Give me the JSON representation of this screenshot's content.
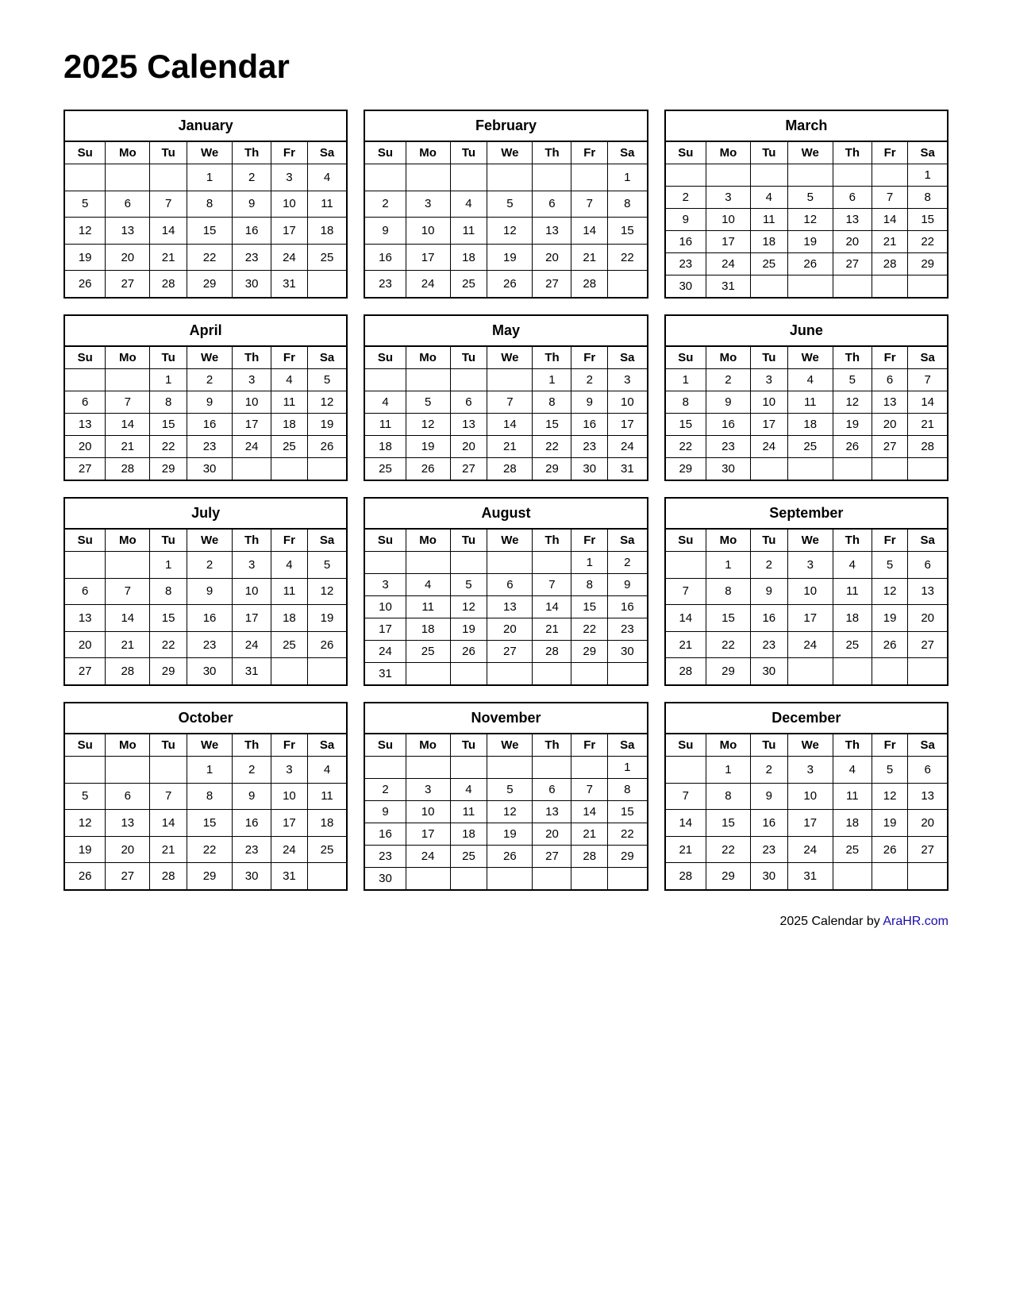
{
  "title": "2025 Calendar",
  "footer": {
    "text": "2025  Calendar by ",
    "link_text": "AraHR.com",
    "link_url": "AraHR.com"
  },
  "months": [
    {
      "name": "January",
      "days_header": [
        "Su",
        "Mo",
        "Tu",
        "We",
        "Th",
        "Fr",
        "Sa"
      ],
      "weeks": [
        [
          "",
          "",
          "",
          "1",
          "2",
          "3",
          "4"
        ],
        [
          "5",
          "6",
          "7",
          "8",
          "9",
          "10",
          "11"
        ],
        [
          "12",
          "13",
          "14",
          "15",
          "16",
          "17",
          "18"
        ],
        [
          "19",
          "20",
          "21",
          "22",
          "23",
          "24",
          "25"
        ],
        [
          "26",
          "27",
          "28",
          "29",
          "30",
          "31",
          ""
        ],
        [
          "",
          "",
          "",
          "",
          "",
          "",
          ""
        ]
      ]
    },
    {
      "name": "February",
      "days_header": [
        "Su",
        "Mo",
        "Tu",
        "We",
        "Th",
        "Fr",
        "Sa"
      ],
      "weeks": [
        [
          "",
          "",
          "",
          "",
          "",
          "",
          "1"
        ],
        [
          "2",
          "3",
          "4",
          "5",
          "6",
          "7",
          "8"
        ],
        [
          "9",
          "10",
          "11",
          "12",
          "13",
          "14",
          "15"
        ],
        [
          "16",
          "17",
          "18",
          "19",
          "20",
          "21",
          "22"
        ],
        [
          "23",
          "24",
          "25",
          "26",
          "27",
          "28",
          ""
        ],
        [
          "",
          "",
          "",
          "",
          "",
          "",
          ""
        ]
      ]
    },
    {
      "name": "March",
      "days_header": [
        "Su",
        "Mo",
        "Tu",
        "We",
        "Th",
        "Fr",
        "Sa"
      ],
      "weeks": [
        [
          "",
          "",
          "",
          "",
          "",
          "",
          "1"
        ],
        [
          "2",
          "3",
          "4",
          "5",
          "6",
          "7",
          "8"
        ],
        [
          "9",
          "10",
          "11",
          "12",
          "13",
          "14",
          "15"
        ],
        [
          "16",
          "17",
          "18",
          "19",
          "20",
          "21",
          "22"
        ],
        [
          "23",
          "24",
          "25",
          "26",
          "27",
          "28",
          "29"
        ],
        [
          "30",
          "31",
          "",
          "",
          "",
          "",
          ""
        ]
      ]
    },
    {
      "name": "April",
      "days_header": [
        "Su",
        "Mo",
        "Tu",
        "We",
        "Th",
        "Fr",
        "Sa"
      ],
      "weeks": [
        [
          "",
          "",
          "1",
          "2",
          "3",
          "4",
          "5"
        ],
        [
          "6",
          "7",
          "8",
          "9",
          "10",
          "11",
          "12"
        ],
        [
          "13",
          "14",
          "15",
          "16",
          "17",
          "18",
          "19"
        ],
        [
          "20",
          "21",
          "22",
          "23",
          "24",
          "25",
          "26"
        ],
        [
          "27",
          "28",
          "29",
          "30",
          "",
          "",
          ""
        ],
        [
          "",
          "",
          "",
          "",
          "",
          "",
          ""
        ]
      ]
    },
    {
      "name": "May",
      "days_header": [
        "Su",
        "Mo",
        "Tu",
        "We",
        "Th",
        "Fr",
        "Sa"
      ],
      "weeks": [
        [
          "",
          "",
          "",
          "",
          "1",
          "2",
          "3"
        ],
        [
          "4",
          "5",
          "6",
          "7",
          "8",
          "9",
          "10"
        ],
        [
          "11",
          "12",
          "13",
          "14",
          "15",
          "16",
          "17"
        ],
        [
          "18",
          "19",
          "20",
          "21",
          "22",
          "23",
          "24"
        ],
        [
          "25",
          "26",
          "27",
          "28",
          "29",
          "30",
          "31"
        ],
        [
          "",
          "",
          "",
          "",
          "",
          "",
          ""
        ]
      ]
    },
    {
      "name": "June",
      "days_header": [
        "Su",
        "Mo",
        "Tu",
        "We",
        "Th",
        "Fr",
        "Sa"
      ],
      "weeks": [
        [
          "1",
          "2",
          "3",
          "4",
          "5",
          "6",
          "7"
        ],
        [
          "8",
          "9",
          "10",
          "11",
          "12",
          "13",
          "14"
        ],
        [
          "15",
          "16",
          "17",
          "18",
          "19",
          "20",
          "21"
        ],
        [
          "22",
          "23",
          "24",
          "25",
          "26",
          "27",
          "28"
        ],
        [
          "29",
          "30",
          "",
          "",
          "",
          "",
          ""
        ],
        [
          "",
          "",
          "",
          "",
          "",
          "",
          ""
        ]
      ]
    },
    {
      "name": "July",
      "days_header": [
        "Su",
        "Mo",
        "Tu",
        "We",
        "Th",
        "Fr",
        "Sa"
      ],
      "weeks": [
        [
          "",
          "",
          "1",
          "2",
          "3",
          "4",
          "5"
        ],
        [
          "6",
          "7",
          "8",
          "9",
          "10",
          "11",
          "12"
        ],
        [
          "13",
          "14",
          "15",
          "16",
          "17",
          "18",
          "19"
        ],
        [
          "20",
          "21",
          "22",
          "23",
          "24",
          "25",
          "26"
        ],
        [
          "27",
          "28",
          "29",
          "30",
          "31",
          "",
          ""
        ],
        [
          "",
          "",
          "",
          "",
          "",
          "",
          ""
        ]
      ]
    },
    {
      "name": "August",
      "days_header": [
        "Su",
        "Mo",
        "Tu",
        "We",
        "Th",
        "Fr",
        "Sa"
      ],
      "weeks": [
        [
          "",
          "",
          "",
          "",
          "",
          "1",
          "2"
        ],
        [
          "3",
          "4",
          "5",
          "6",
          "7",
          "8",
          "9"
        ],
        [
          "10",
          "11",
          "12",
          "13",
          "14",
          "15",
          "16"
        ],
        [
          "17",
          "18",
          "19",
          "20",
          "21",
          "22",
          "23"
        ],
        [
          "24",
          "25",
          "26",
          "27",
          "28",
          "29",
          "30"
        ],
        [
          "31",
          "",
          "",
          "",
          "",
          "",
          ""
        ]
      ]
    },
    {
      "name": "September",
      "days_header": [
        "Su",
        "Mo",
        "Tu",
        "We",
        "Th",
        "Fr",
        "Sa"
      ],
      "weeks": [
        [
          "",
          "1",
          "2",
          "3",
          "4",
          "5",
          "6"
        ],
        [
          "7",
          "8",
          "9",
          "10",
          "11",
          "12",
          "13"
        ],
        [
          "14",
          "15",
          "16",
          "17",
          "18",
          "19",
          "20"
        ],
        [
          "21",
          "22",
          "23",
          "24",
          "25",
          "26",
          "27"
        ],
        [
          "28",
          "29",
          "30",
          "",
          "",
          "",
          ""
        ],
        [
          "",
          "",
          "",
          "",
          "",
          "",
          ""
        ]
      ]
    },
    {
      "name": "October",
      "days_header": [
        "Su",
        "Mo",
        "Tu",
        "We",
        "Th",
        "Fr",
        "Sa"
      ],
      "weeks": [
        [
          "",
          "",
          "",
          "1",
          "2",
          "3",
          "4"
        ],
        [
          "5",
          "6",
          "7",
          "8",
          "9",
          "10",
          "11"
        ],
        [
          "12",
          "13",
          "14",
          "15",
          "16",
          "17",
          "18"
        ],
        [
          "19",
          "20",
          "21",
          "22",
          "23",
          "24",
          "25"
        ],
        [
          "26",
          "27",
          "28",
          "29",
          "30",
          "31",
          ""
        ],
        [
          "",
          "",
          "",
          "",
          "",
          "",
          ""
        ]
      ]
    },
    {
      "name": "November",
      "days_header": [
        "Su",
        "Mo",
        "Tu",
        "We",
        "Th",
        "Fr",
        "Sa"
      ],
      "weeks": [
        [
          "",
          "",
          "",
          "",
          "",
          "",
          "1"
        ],
        [
          "2",
          "3",
          "4",
          "5",
          "6",
          "7",
          "8"
        ],
        [
          "9",
          "10",
          "11",
          "12",
          "13",
          "14",
          "15"
        ],
        [
          "16",
          "17",
          "18",
          "19",
          "20",
          "21",
          "22"
        ],
        [
          "23",
          "24",
          "25",
          "26",
          "27",
          "28",
          "29"
        ],
        [
          "30",
          "",
          "",
          "",
          "",
          "",
          ""
        ]
      ]
    },
    {
      "name": "December",
      "days_header": [
        "Su",
        "Mo",
        "Tu",
        "We",
        "Th",
        "Fr",
        "Sa"
      ],
      "weeks": [
        [
          "",
          "1",
          "2",
          "3",
          "4",
          "5",
          "6"
        ],
        [
          "7",
          "8",
          "9",
          "10",
          "11",
          "12",
          "13"
        ],
        [
          "14",
          "15",
          "16",
          "17",
          "18",
          "19",
          "20"
        ],
        [
          "21",
          "22",
          "23",
          "24",
          "25",
          "26",
          "27"
        ],
        [
          "28",
          "29",
          "30",
          "31",
          "",
          "",
          ""
        ],
        [
          "",
          "",
          "",
          "",
          "",
          "",
          ""
        ]
      ]
    }
  ]
}
